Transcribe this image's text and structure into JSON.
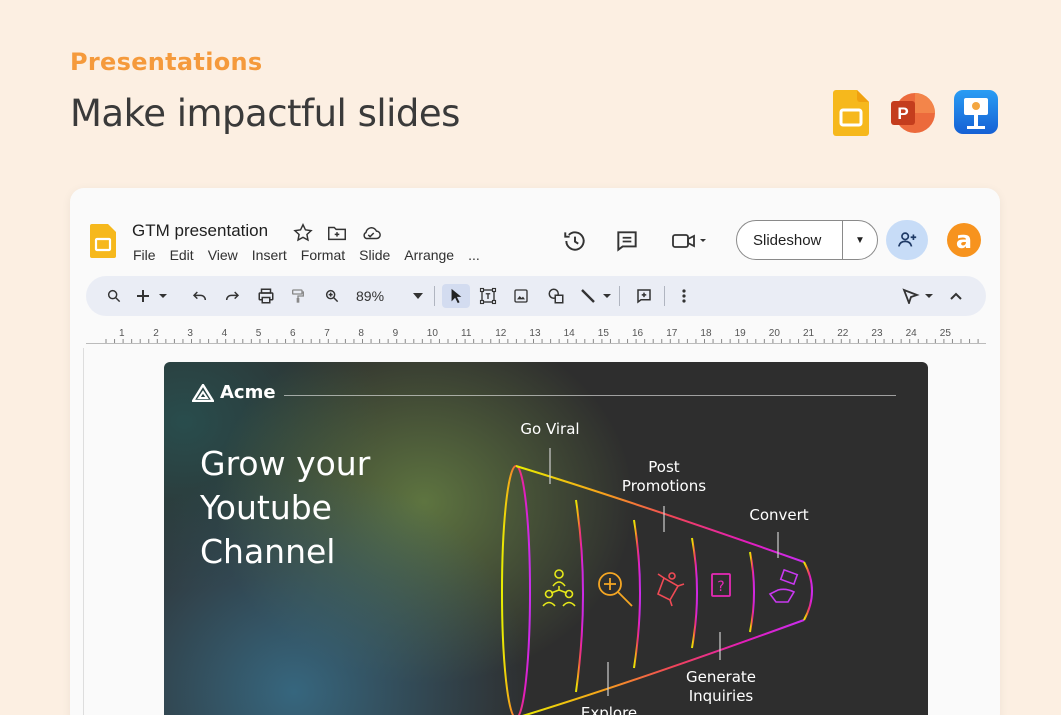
{
  "page": {
    "eyebrow": "Presentations",
    "headline": "Make impactful slides",
    "app_icons": [
      "google-slides-icon",
      "powerpoint-icon",
      "keynote-icon"
    ]
  },
  "window": {
    "doc_title": "GTM presentation",
    "menu": [
      "File",
      "Edit",
      "View",
      "Insert",
      "Format",
      "Slide",
      "Arrange",
      "..."
    ],
    "slideshow_label": "Slideshow",
    "avatar_letter": "a",
    "zoom": "89%",
    "ruler_numbers": [
      "1",
      "2",
      "3",
      "4",
      "5",
      "6",
      "7",
      "8",
      "9",
      "10",
      "11",
      "12",
      "13",
      "14",
      "15",
      "16",
      "17",
      "18",
      "19",
      "20",
      "21",
      "22",
      "23",
      "24",
      "25"
    ]
  },
  "slide": {
    "brand": "Acme",
    "heading": "Grow your Youtube Channel",
    "stages": [
      {
        "label": "Go Viral",
        "icon": "people-network-icon"
      },
      {
        "label": "Explore",
        "icon": "zoom-icon"
      },
      {
        "label": "Post Promotions",
        "icon": "megaphone-icon"
      },
      {
        "label": "Generate Inquiries",
        "icon": "question-icon"
      },
      {
        "label": "Convert",
        "icon": "money-hand-icon"
      }
    ]
  },
  "colors": {
    "background": "#fcefe2",
    "eyebrow": "#f59a3c",
    "avatar": "#f7931e",
    "share_button": "#c7dcf7"
  }
}
